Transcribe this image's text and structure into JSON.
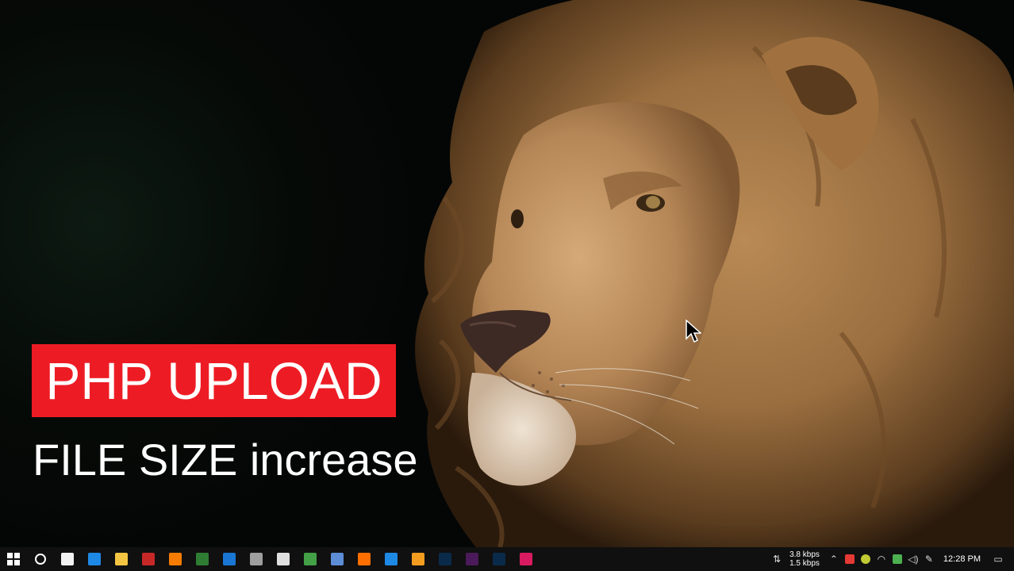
{
  "overlay": {
    "title": "PHP UPLOAD",
    "subtitle": "FILE SIZE increase",
    "title_bg_color": "#ed1c24"
  },
  "taskbar": {
    "start_icon": "windows-start-icon",
    "search_icon": "cortana-circle-icon",
    "apps": [
      {
        "name": "store-app-icon",
        "color": "#f2f2f2"
      },
      {
        "name": "edge-app-icon",
        "color": "#1e88e5"
      },
      {
        "name": "file-explorer-app-icon",
        "color": "#f4c542"
      },
      {
        "name": "filezilla-app-icon",
        "color": "#c62828"
      },
      {
        "name": "sublime-text-app-icon",
        "color": "#f57c00"
      },
      {
        "name": "globe-app-icon",
        "color": "#2e7d32"
      },
      {
        "name": "vscode-app-icon",
        "color": "#1976d2"
      },
      {
        "name": "tool-app-icon",
        "color": "#9e9e9e"
      },
      {
        "name": "bird-app-icon",
        "color": "#e0e0e0"
      },
      {
        "name": "chrome-app-icon",
        "color": "#43a047"
      },
      {
        "name": "chrome-app-icon-2",
        "color": "#5c8dd6"
      },
      {
        "name": "firefox-app-icon",
        "color": "#ff6f00"
      },
      {
        "name": "bird-blue-app-icon",
        "color": "#1e88e5"
      },
      {
        "name": "illustrator-app-icon",
        "color": "#f29d1f"
      },
      {
        "name": "photoshop-app-icon",
        "color": "#0a2a4a"
      },
      {
        "name": "purple-app-icon",
        "color": "#4a1a5a"
      },
      {
        "name": "photoshop-app-icon-2",
        "color": "#0a2a4a"
      },
      {
        "name": "pink-app-icon",
        "color": "#d81b60"
      }
    ],
    "net_speed_up": "3.8 kbps",
    "net_speed_down": "1.5 kbps",
    "clock": "12:28 PM"
  }
}
